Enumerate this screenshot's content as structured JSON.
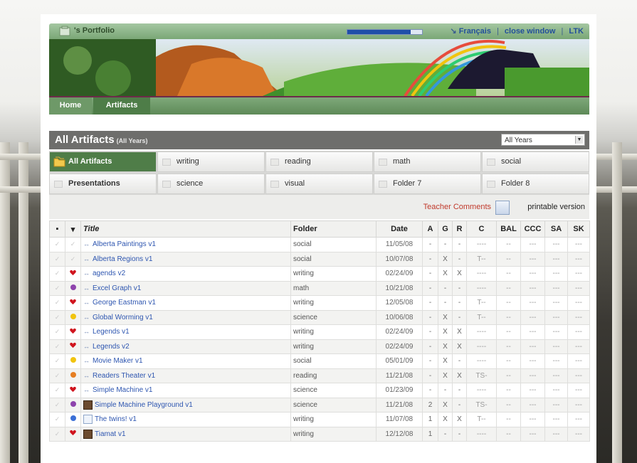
{
  "header": {
    "title": "'s Portfolio",
    "progress": 0.85,
    "links": [
      "Français",
      "close window",
      "LTK"
    ]
  },
  "nav": {
    "home": "Home",
    "artifacts": "Artifacts"
  },
  "panel": {
    "title": "All Artifacts",
    "subtitle": "(All Years)",
    "year_select": "All Years"
  },
  "folders": [
    "All Artifacts",
    "writing",
    "reading",
    "math",
    "social",
    "Presentations",
    "science",
    "visual",
    "Folder 7",
    "Folder 8"
  ],
  "tools": {
    "teacher_comments": "Teacher Comments",
    "printable": "printable version"
  },
  "table": {
    "columns": [
      "Title",
      "Folder",
      "Date",
      "A",
      "G",
      "R",
      "C",
      "BAL",
      "CCC",
      "SA",
      "SK"
    ],
    "rows": [
      {
        "mark": "none",
        "title": "Alberta Paintings v1",
        "folder": "social",
        "date": "11/05/08",
        "a": "-",
        "g": "-",
        "r": "-",
        "c": "----",
        "bal": "--",
        "ccc": "---",
        "sa": "---",
        "sk": "---"
      },
      {
        "mark": "none",
        "title": "Alberta Regions v1",
        "folder": "social",
        "date": "10/07/08",
        "a": "-",
        "g": "X",
        "r": "-",
        "c": "T--",
        "bal": "--",
        "ccc": "---",
        "sa": "---",
        "sk": "---"
      },
      {
        "mark": "heart",
        "title": "agends v2",
        "folder": "writing",
        "date": "02/24/09",
        "a": "-",
        "g": "X",
        "r": "X",
        "c": "----",
        "bal": "--",
        "ccc": "---",
        "sa": "---",
        "sk": "---"
      },
      {
        "mark": "purple",
        "title": "Excel Graph v1",
        "folder": "math",
        "date": "10/21/08",
        "a": "-",
        "g": "-",
        "r": "-",
        "c": "----",
        "bal": "--",
        "ccc": "---",
        "sa": "---",
        "sk": "---"
      },
      {
        "mark": "heart",
        "title": "George Eastman v1",
        "folder": "writing",
        "date": "12/05/08",
        "a": "-",
        "g": "-",
        "r": "-",
        "c": "T--",
        "bal": "--",
        "ccc": "---",
        "sa": "---",
        "sk": "---"
      },
      {
        "mark": "yellow",
        "title": "Global Worming v1",
        "folder": "science",
        "date": "10/06/08",
        "a": "-",
        "g": "X",
        "r": "-",
        "c": "T--",
        "bal": "--",
        "ccc": "---",
        "sa": "---",
        "sk": "---"
      },
      {
        "mark": "heart",
        "title": "Legends v1",
        "folder": "writing",
        "date": "02/24/09",
        "a": "-",
        "g": "X",
        "r": "X",
        "c": "----",
        "bal": "--",
        "ccc": "---",
        "sa": "---",
        "sk": "---"
      },
      {
        "mark": "heart",
        "title": "Legends v2",
        "folder": "writing",
        "date": "02/24/09",
        "a": "-",
        "g": "X",
        "r": "X",
        "c": "----",
        "bal": "--",
        "ccc": "---",
        "sa": "---",
        "sk": "---"
      },
      {
        "mark": "yellow",
        "title": "Movie Maker v1",
        "folder": "social",
        "date": "05/01/09",
        "a": "-",
        "g": "X",
        "r": "-",
        "c": "----",
        "bal": "--",
        "ccc": "---",
        "sa": "---",
        "sk": "---"
      },
      {
        "mark": "orange",
        "title": "Readers Theater v1",
        "folder": "reading",
        "date": "11/21/08",
        "a": "-",
        "g": "X",
        "r": "X",
        "c": "TS-",
        "bal": "--",
        "ccc": "---",
        "sa": "---",
        "sk": "---"
      },
      {
        "mark": "heart",
        "title": "Simple Machine v1",
        "folder": "science",
        "date": "01/23/09",
        "a": "-",
        "g": "-",
        "r": "-",
        "c": "----",
        "bal": "--",
        "ccc": "---",
        "sa": "---",
        "sk": "---"
      },
      {
        "mark": "purple",
        "title": "Simple Machine Playground v1",
        "folder": "science",
        "date": "11/21/08",
        "a": "2",
        "g": "X",
        "r": "-",
        "c": "TS-",
        "bal": "--",
        "ccc": "---",
        "sa": "---",
        "sk": "---"
      },
      {
        "mark": "blue",
        "title": "The twins! v1",
        "folder": "writing",
        "date": "11/07/08",
        "a": "1",
        "g": "X",
        "r": "X",
        "c": "T--",
        "bal": "--",
        "ccc": "---",
        "sa": "---",
        "sk": "---"
      },
      {
        "mark": "heart",
        "title": "Tiamat v1",
        "folder": "writing",
        "date": "12/12/08",
        "a": "1",
        "g": "-",
        "r": "-",
        "c": "----",
        "bal": "--",
        "ccc": "---",
        "sa": "---",
        "sk": "---"
      }
    ]
  },
  "colors": {
    "accent_green": "#4f7d48",
    "link_blue": "#2e56b0",
    "heart_red": "#d0141e"
  }
}
